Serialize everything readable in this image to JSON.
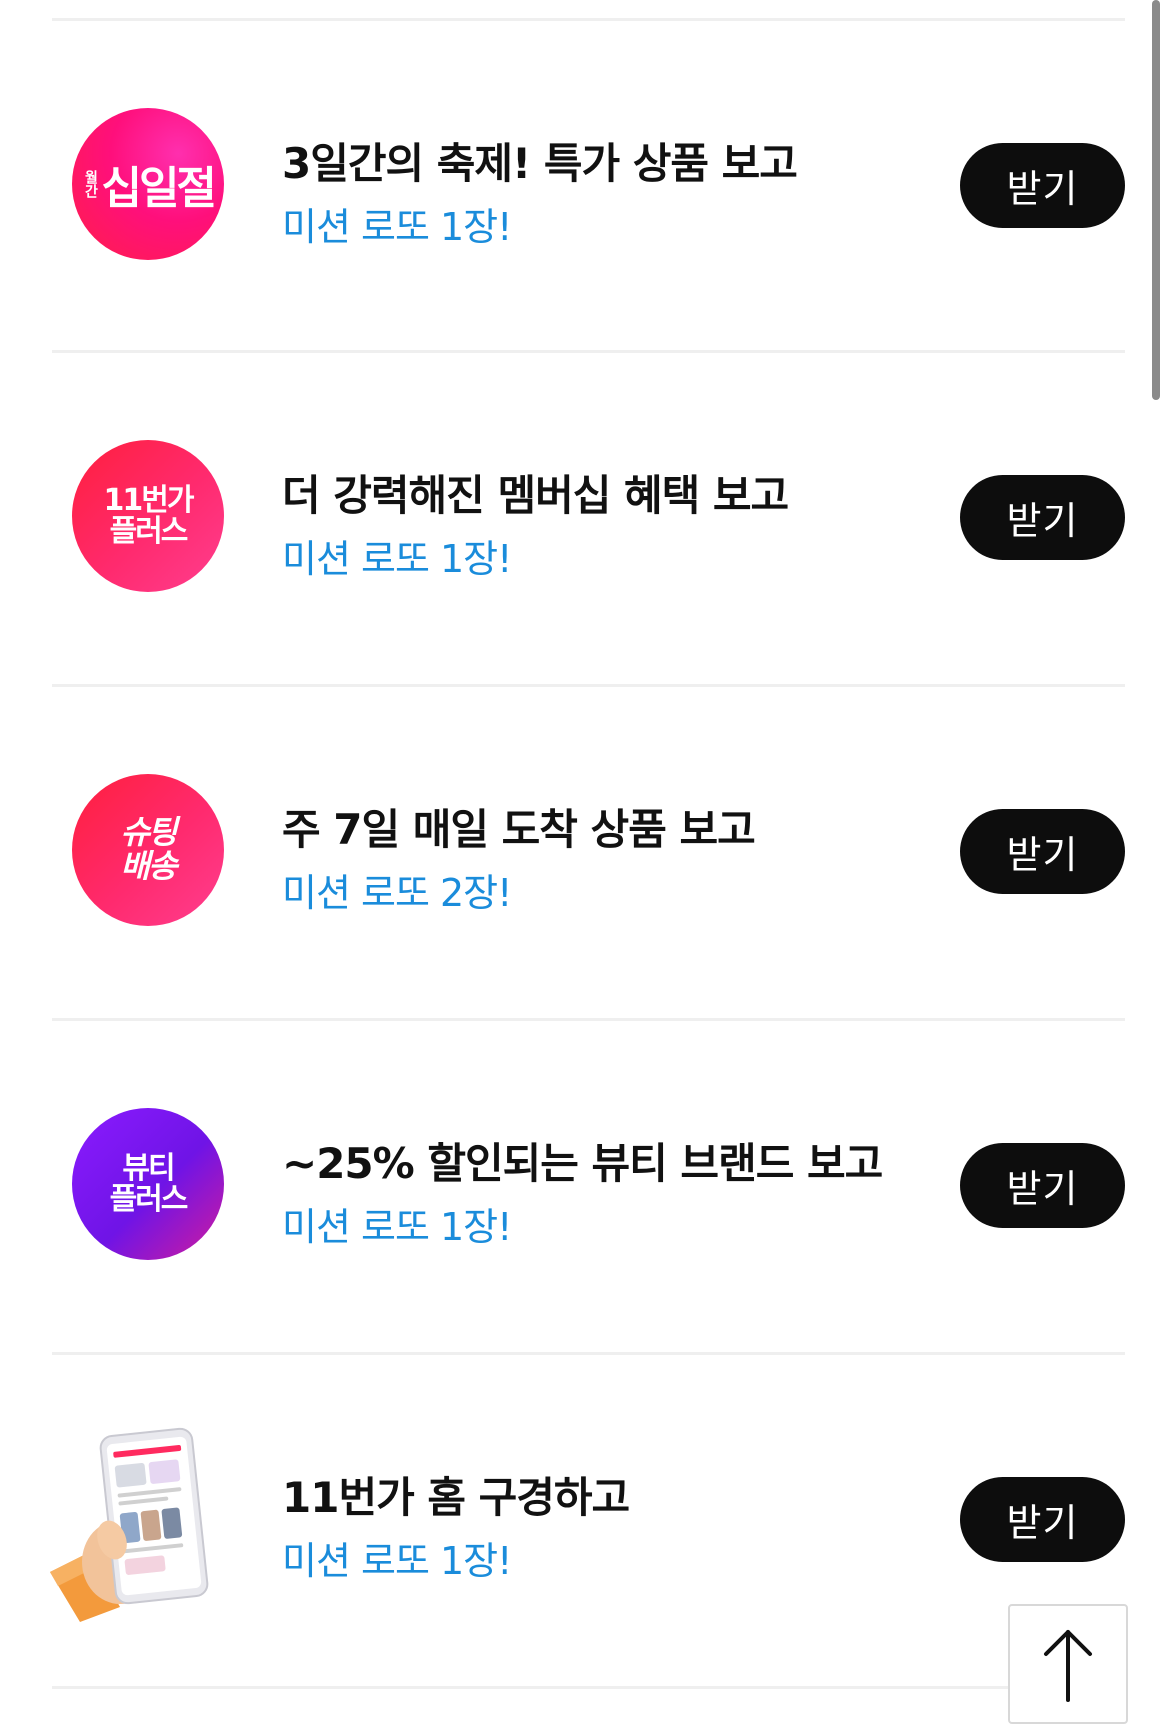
{
  "missions": [
    {
      "logo": {
        "icon": "festival-logo-icon",
        "main_text": "십일절",
        "side_text": "월간"
      },
      "title": "3일간의 축제! 특가 상품 보고",
      "reward": "미션 로또 1장!",
      "button": "받기"
    },
    {
      "logo": {
        "icon": "11st-plus-logo-icon",
        "line1": "11번가",
        "line2": "플러스"
      },
      "title": "더 강력해진 멤버십 혜택 보고",
      "reward": "미션 로또 1장!",
      "button": "받기"
    },
    {
      "logo": {
        "icon": "shooting-delivery-logo-icon",
        "line1": "슈팅",
        "line2": "배송"
      },
      "title": "주 7일 매일 도착 상품 보고",
      "reward": "미션 로또 2장!",
      "button": "받기"
    },
    {
      "logo": {
        "icon": "beauty-plus-logo-icon",
        "line1": "뷰티",
        "line2": "플러스"
      },
      "title": "~25% 할인되는 뷰티 브랜드 보고",
      "reward": "미션 로또 1장!",
      "button": "받기"
    },
    {
      "logo": {
        "icon": "phone-in-hand-icon"
      },
      "title": "11번가 홈 구경하고",
      "reward": "미션 로또 1장!",
      "button": "받기"
    }
  ],
  "scroll_top": {
    "icon": "arrow-up-icon"
  },
  "colors": {
    "reward_text": "#1a8cdb",
    "button_bg": "#0d0d0d",
    "festival": "#ff0f7b",
    "plus": "#ff1f3d",
    "beauty": "#8b1bff"
  }
}
